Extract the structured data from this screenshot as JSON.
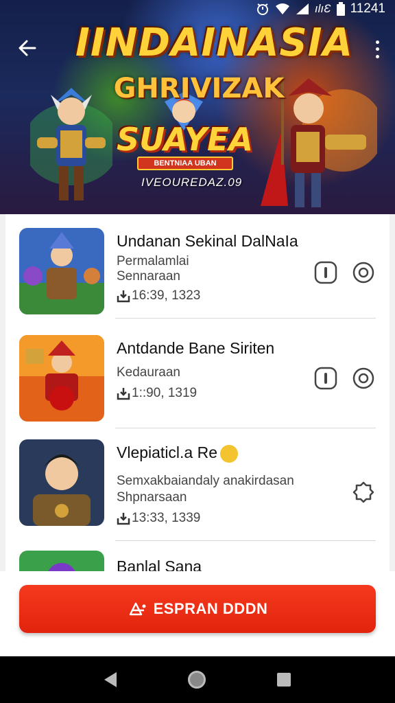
{
  "status_bar": {
    "time": "11241",
    "icons": [
      "alarm-icon",
      "wifi-icon",
      "signal-icon",
      "signal-icon",
      "battery-icon"
    ],
    "carrier_text": "ılıƐ"
  },
  "banner": {
    "title_line1": "IINDAINASIA",
    "title_line2": "GHRIVIZAK",
    "title_line3": "SUAYEA",
    "plate_text": "BENTNIAA UBAN",
    "date_text": "IVEOUREDAZ.09"
  },
  "list": {
    "items": [
      {
        "title": "Undanan Sekinal DalNaIa",
        "sub1": "Permalamlai",
        "sub2": "Sennaraan",
        "meta": "16:39, 1323",
        "actions": [
          "phone-icon",
          "circle-dot-icon"
        ]
      },
      {
        "title": "Antdande Bane Siriten",
        "sub1": "Kedauraan",
        "sub2": "",
        "meta": "1::90, 1319",
        "actions": [
          "phone-icon",
          "circle-dot-icon"
        ]
      },
      {
        "title": "Vlepiaticl.a  Re",
        "sub1": "Semxakbaiandaly anakirdasan",
        "sub2": "Shpnarsaan",
        "meta": "13:33, 1339",
        "actions": [
          "badge-icon"
        ]
      },
      {
        "title": "Banlal Sana",
        "sub1": "",
        "sub2": "",
        "meta": "",
        "actions": []
      }
    ]
  },
  "cta": {
    "label": "ESPRAN DDDN",
    "icon": "scatter-icon"
  },
  "colors": {
    "cta": "#e82a12",
    "banner_title": "#ffd23a",
    "emoji": "#f4c430"
  }
}
